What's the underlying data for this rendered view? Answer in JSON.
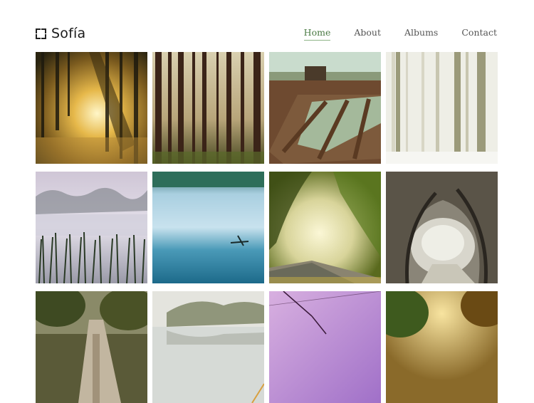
{
  "brand": {
    "name": "Sofía",
    "logo_icon": "bracket-frame-icon"
  },
  "nav": {
    "items": [
      {
        "label": "Home",
        "active": true
      },
      {
        "label": "About",
        "active": false
      },
      {
        "label": "Albums",
        "active": false
      },
      {
        "label": "Contact",
        "active": false
      }
    ],
    "active_color": "#4a7a43"
  },
  "gallery": {
    "photos": [
      {
        "subject": "sunlit forest with rays"
      },
      {
        "subject": "tall pine trunks in mist"
      },
      {
        "subject": "muddy field with puddles"
      },
      {
        "subject": "snowy birch forest"
      },
      {
        "subject": "misty lake with reeds"
      },
      {
        "subject": "blue lake with fog"
      },
      {
        "subject": "sunny road under trees"
      },
      {
        "subject": "frosted tree tunnel road"
      },
      {
        "subject": "forest path"
      },
      {
        "subject": "misty island lake"
      },
      {
        "subject": "purple sky with wires"
      },
      {
        "subject": "golden foliage"
      }
    ]
  }
}
